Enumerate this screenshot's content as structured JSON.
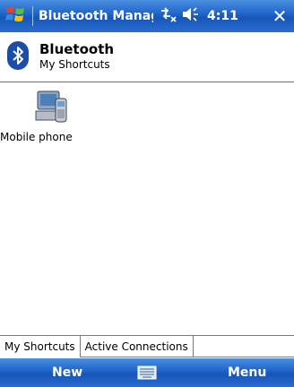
{
  "titlebar": {
    "app_title": "Bluetooth Manager",
    "time": "4:11",
    "close_label": "✕"
  },
  "header": {
    "title": "Bluetooth",
    "subtitle": "My Shortcuts"
  },
  "shortcuts": [
    {
      "label": "Mobile phone",
      "icon": "mobile-phone-icon"
    }
  ],
  "tabs": [
    {
      "label": "My Shortcuts",
      "active": true
    },
    {
      "label": "Active Connections",
      "active": false
    }
  ],
  "menubar": {
    "left_softkey": "New",
    "right_softkey": "Menu"
  },
  "colors": {
    "bar_blue": "#1d62c9",
    "bluetooth_blue": "#1c4ea8"
  }
}
